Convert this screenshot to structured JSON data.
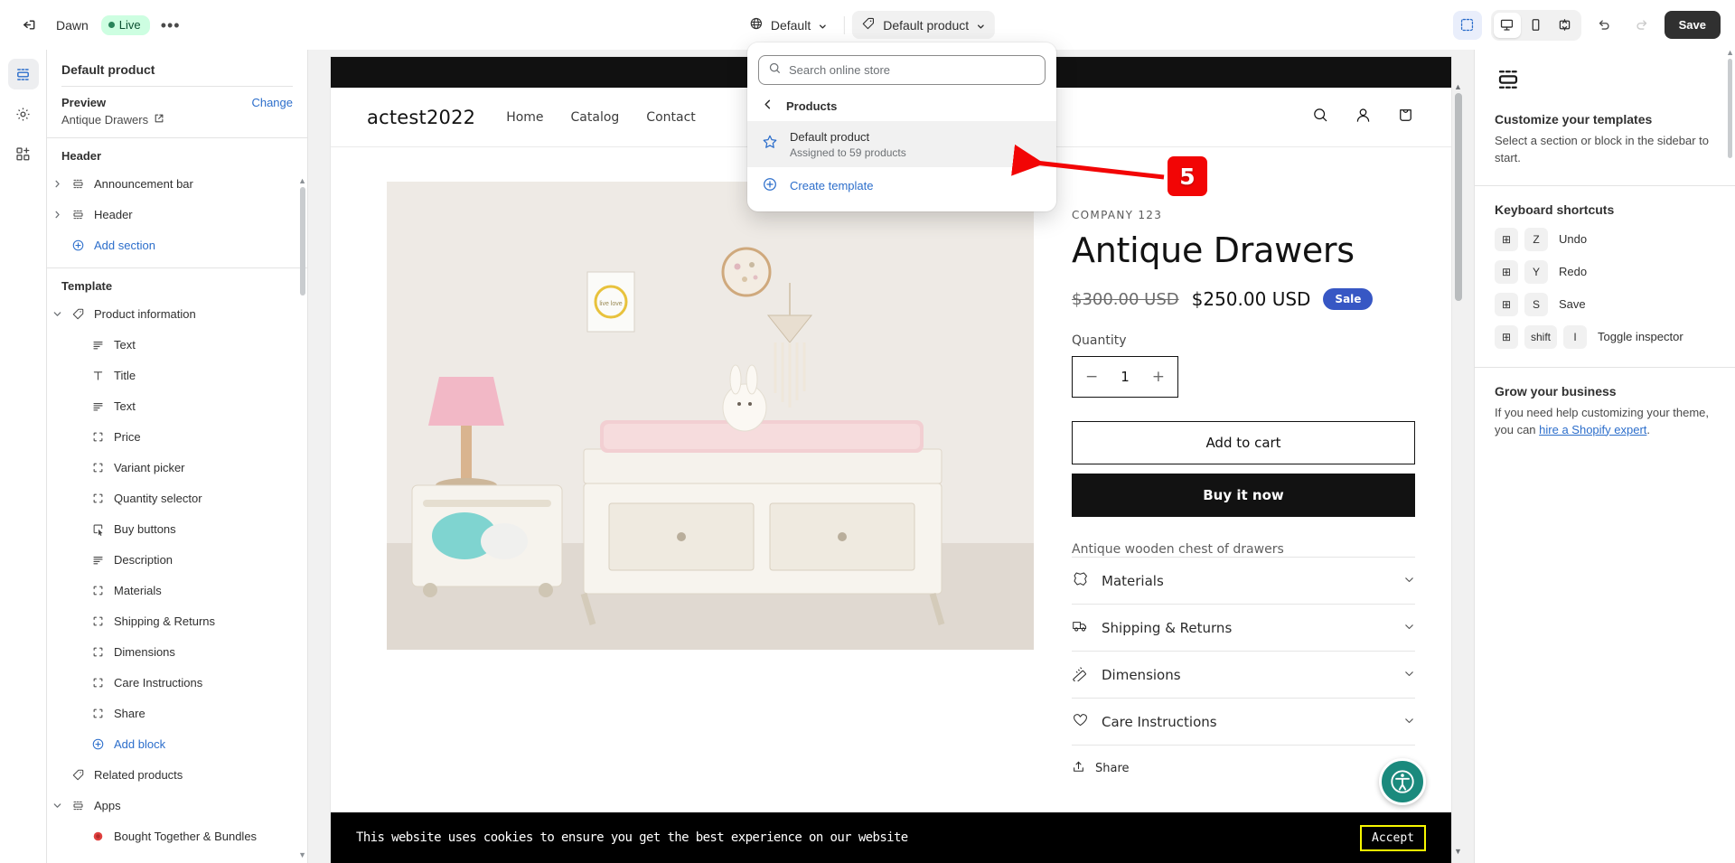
{
  "topbar": {
    "exit_icon": "exit-icon",
    "theme_name": "Dawn",
    "live_label": "Live",
    "more_label": "•••",
    "locale_selector": {
      "icon": "globe-icon",
      "label": "Default"
    },
    "template_selector": {
      "icon": "tag-icon",
      "label": "Default product"
    },
    "devices": [
      {
        "name": "desktop",
        "icon": "desktop-icon",
        "selected": true
      },
      {
        "name": "mobile",
        "icon": "mobile-icon",
        "selected": false
      },
      {
        "name": "fullscreen",
        "icon": "fullwidth-icon",
        "selected": false
      }
    ],
    "select_tool": "cursor-select-icon",
    "undo": "undo-icon",
    "redo": "redo-icon",
    "save_label": "Save"
  },
  "rail": {
    "items": [
      {
        "name": "sections",
        "icon": "sections-icon",
        "active": true
      },
      {
        "name": "theme-settings",
        "icon": "gear-icon",
        "active": false
      },
      {
        "name": "apps",
        "icon": "apps-add-icon",
        "active": false
      }
    ]
  },
  "sidebar": {
    "title": "Default product",
    "preview_label": "Preview",
    "change_label": "Change",
    "preview_value": "Antique Drawers",
    "groups": [
      {
        "label": "Header",
        "items": [
          {
            "label": "Announcement bar",
            "icon": "section-icon",
            "twisty": "right",
            "indent": 0
          },
          {
            "label": "Header",
            "icon": "section-icon",
            "twisty": "right",
            "indent": 0
          },
          {
            "label": "Add section",
            "icon": "plus-circle-icon",
            "twisty": "none",
            "indent": 0,
            "link": true
          }
        ]
      },
      {
        "label": "Template",
        "items": [
          {
            "label": "Product information",
            "icon": "tag-icon",
            "twisty": "down",
            "indent": 0
          },
          {
            "label": "Text",
            "icon": "text-icon",
            "twisty": "none",
            "indent": 1
          },
          {
            "label": "Title",
            "icon": "title-icon",
            "twisty": "none",
            "indent": 1
          },
          {
            "label": "Text",
            "icon": "text-icon",
            "twisty": "none",
            "indent": 1
          },
          {
            "label": "Price",
            "icon": "block-icon",
            "twisty": "none",
            "indent": 1
          },
          {
            "label": "Variant picker",
            "icon": "block-icon",
            "twisty": "none",
            "indent": 1
          },
          {
            "label": "Quantity selector",
            "icon": "block-icon",
            "twisty": "none",
            "indent": 1
          },
          {
            "label": "Buy buttons",
            "icon": "buybutton-icon",
            "twisty": "none",
            "indent": 1
          },
          {
            "label": "Description",
            "icon": "text-icon",
            "twisty": "none",
            "indent": 1
          },
          {
            "label": "Materials",
            "icon": "block-icon",
            "twisty": "none",
            "indent": 1
          },
          {
            "label": "Shipping & Returns",
            "icon": "block-icon",
            "twisty": "none",
            "indent": 1
          },
          {
            "label": "Dimensions",
            "icon": "block-icon",
            "twisty": "none",
            "indent": 1
          },
          {
            "label": "Care Instructions",
            "icon": "block-icon",
            "twisty": "none",
            "indent": 1
          },
          {
            "label": "Share",
            "icon": "block-icon",
            "twisty": "none",
            "indent": 1
          },
          {
            "label": "Add block",
            "icon": "plus-circle-icon",
            "twisty": "none",
            "indent": 1,
            "link": true
          },
          {
            "label": "Related products",
            "icon": "tag-icon",
            "twisty": "none",
            "indent": 0
          },
          {
            "label": "Apps",
            "icon": "sections-icon",
            "twisty": "down",
            "indent": 0
          },
          {
            "label": "Bought Together & Bundles",
            "icon": "app-dot-icon",
            "twisty": "none",
            "indent": 1
          }
        ]
      }
    ]
  },
  "popover": {
    "search_placeholder": "Search online store",
    "search_value": "",
    "back_label": "Products",
    "items": [
      {
        "title": "Default product",
        "subtitle": "Assigned to 59 products",
        "icon": "star-icon",
        "highlight": true
      }
    ],
    "create_label": "Create template"
  },
  "annotation": {
    "step_number": "5"
  },
  "preview": {
    "store": {
      "logo": "actest2022",
      "nav": [
        "Home",
        "Catalog",
        "Contact"
      ],
      "icons": [
        "search-icon",
        "account-icon",
        "cart-icon"
      ]
    },
    "product": {
      "vendor": "COMPANY 123",
      "title": "Antique Drawers",
      "price_compare": "$300.00 USD",
      "price": "$250.00 USD",
      "sale_badge": "Sale",
      "quantity_label": "Quantity",
      "quantity_value": "1",
      "add_to_cart": "Add to cart",
      "buy_now": "Buy it now",
      "description": "Antique wooden chest of drawers",
      "accordions": [
        {
          "label": "Materials",
          "icon": "leather-icon"
        },
        {
          "label": "Shipping & Returns",
          "icon": "truck-icon"
        },
        {
          "label": "Dimensions",
          "icon": "ruler-icon"
        },
        {
          "label": "Care Instructions",
          "icon": "heart-icon"
        }
      ],
      "share_label": "Share"
    },
    "cookie": {
      "text": "This website uses cookies to ensure you get the best experience on our website",
      "accept": "Accept"
    },
    "accessibility_widget": "accessibility-icon"
  },
  "rightpanel": {
    "icon": "sections-icon",
    "heading": "Customize your templates",
    "body": "Select a section or block in the sidebar to start.",
    "shortcuts_heading": "Keyboard shortcuts",
    "shortcuts": [
      {
        "keys": [
          "⊞",
          "Z"
        ],
        "label": "Undo"
      },
      {
        "keys": [
          "⊞",
          "Y"
        ],
        "label": "Redo"
      },
      {
        "keys": [
          "⊞",
          "S"
        ],
        "label": "Save"
      },
      {
        "keys": [
          "⊞",
          "shift",
          "I"
        ],
        "label": "Toggle inspector"
      }
    ],
    "grow_heading": "Grow your business",
    "grow_body_pre": "If you need help customizing your theme, you can ",
    "grow_link": "hire a Shopify expert",
    "grow_body_post": "."
  },
  "colors": {
    "accent": "#2c6ecb",
    "live": "#cdfee1",
    "annotation": "#f20505",
    "sale": "#3757c4"
  }
}
